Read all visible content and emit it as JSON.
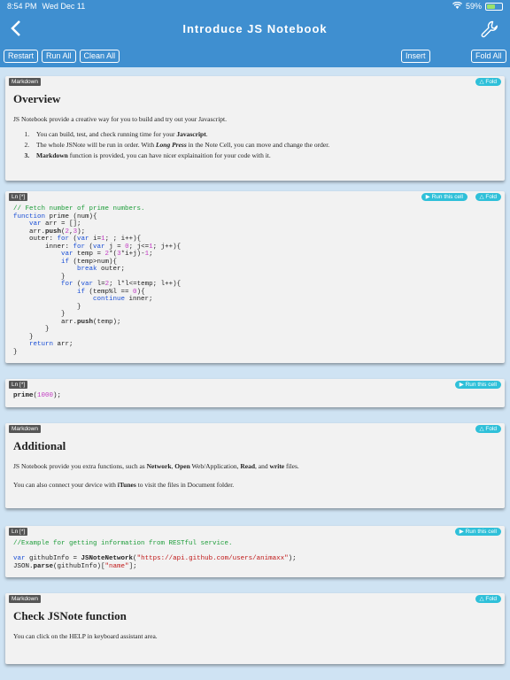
{
  "status": {
    "time": "8:54 PM",
    "date": "Wed Dec 11",
    "battery": "59%",
    "battery_level": 0.59
  },
  "nav": {
    "title": "Introduce JS Notebook"
  },
  "toolbar": {
    "restart": "Restart",
    "run_all": "Run All",
    "clean_all": "Clean All",
    "insert": "Insert",
    "fold_all": "Fold All"
  },
  "cells": {
    "c1": {
      "tag": "Markdown",
      "fold": "△ Fold",
      "heading": "Overview",
      "para": "JS Notebook provide a creative way for you to build and try out your Javascript.",
      "item1_pre": "You can build, test, and check running time for your ",
      "item1_bold": "Javascript",
      "item1_post": ".",
      "item2_pre": "The whole JSNote will be run in order. With ",
      "item2_em": "Long Press",
      "item2_post": " in the Note Cell, you can move and change the order.",
      "item3_bold": "Markdown",
      "item3_post": " function is provided, you can have nicer explainaition for your code with it."
    },
    "c2": {
      "tag": "Ln [*]",
      "run": "▶ Run this cell",
      "fold": "△ Fold"
    },
    "c3": {
      "tag": "Ln [*]",
      "run": "▶ Run this cell"
    },
    "c4": {
      "tag": "Markdown",
      "fold": "△ Fold",
      "heading": "Additional",
      "p1_a": "JS Notebook provide you extra functions, such as ",
      "p1_b": "Network",
      "p1_c": ", ",
      "p1_d": "Open",
      "p1_e": " Web/Application, ",
      "p1_f": "Read",
      "p1_g": ", and ",
      "p1_h": "write",
      "p1_i": " files.",
      "p2_a": "You can also connect your device with ",
      "p2_b": "iTunes",
      "p2_c": " to visit the files in Document folder."
    },
    "c5": {
      "tag": "Ln [*]",
      "run": "▶ Run this cell"
    },
    "c6": {
      "tag": "Markdown",
      "fold": "△ Fold",
      "heading": "Check JSNote function",
      "para": "You can click on the HELP in keyboard assistant area."
    }
  },
  "code": {
    "cell2": [
      "// Fetch number of prime numbers.",
      "function prime (num){",
      "    var arr = [];",
      "    arr.push(2,3);",
      "    outer: for (var i=1; ; i++){",
      "        inner: for (var j = 0; j<=1; j++){",
      "            var temp = 2*(3*i+j)-1;",
      "            if (temp>num){",
      "                break outer;",
      "            }",
      "            for (var l=2; l*l<=temp; l++){",
      "                if (temp%l == 0){",
      "                    continue inner;",
      "                }",
      "            }",
      "            arr.push(temp);",
      "        }",
      "    }",
      "    return arr;",
      "}"
    ],
    "cell3": [
      "prime(1000);"
    ],
    "cell5": [
      "//Example for getting information from RESTful service.",
      "",
      "var githubInfo = JSNoteNetwork(\"https://api.github.com/users/animaxx\");",
      "JSON.parse(githubInfo)[\"name\"];"
    ]
  }
}
